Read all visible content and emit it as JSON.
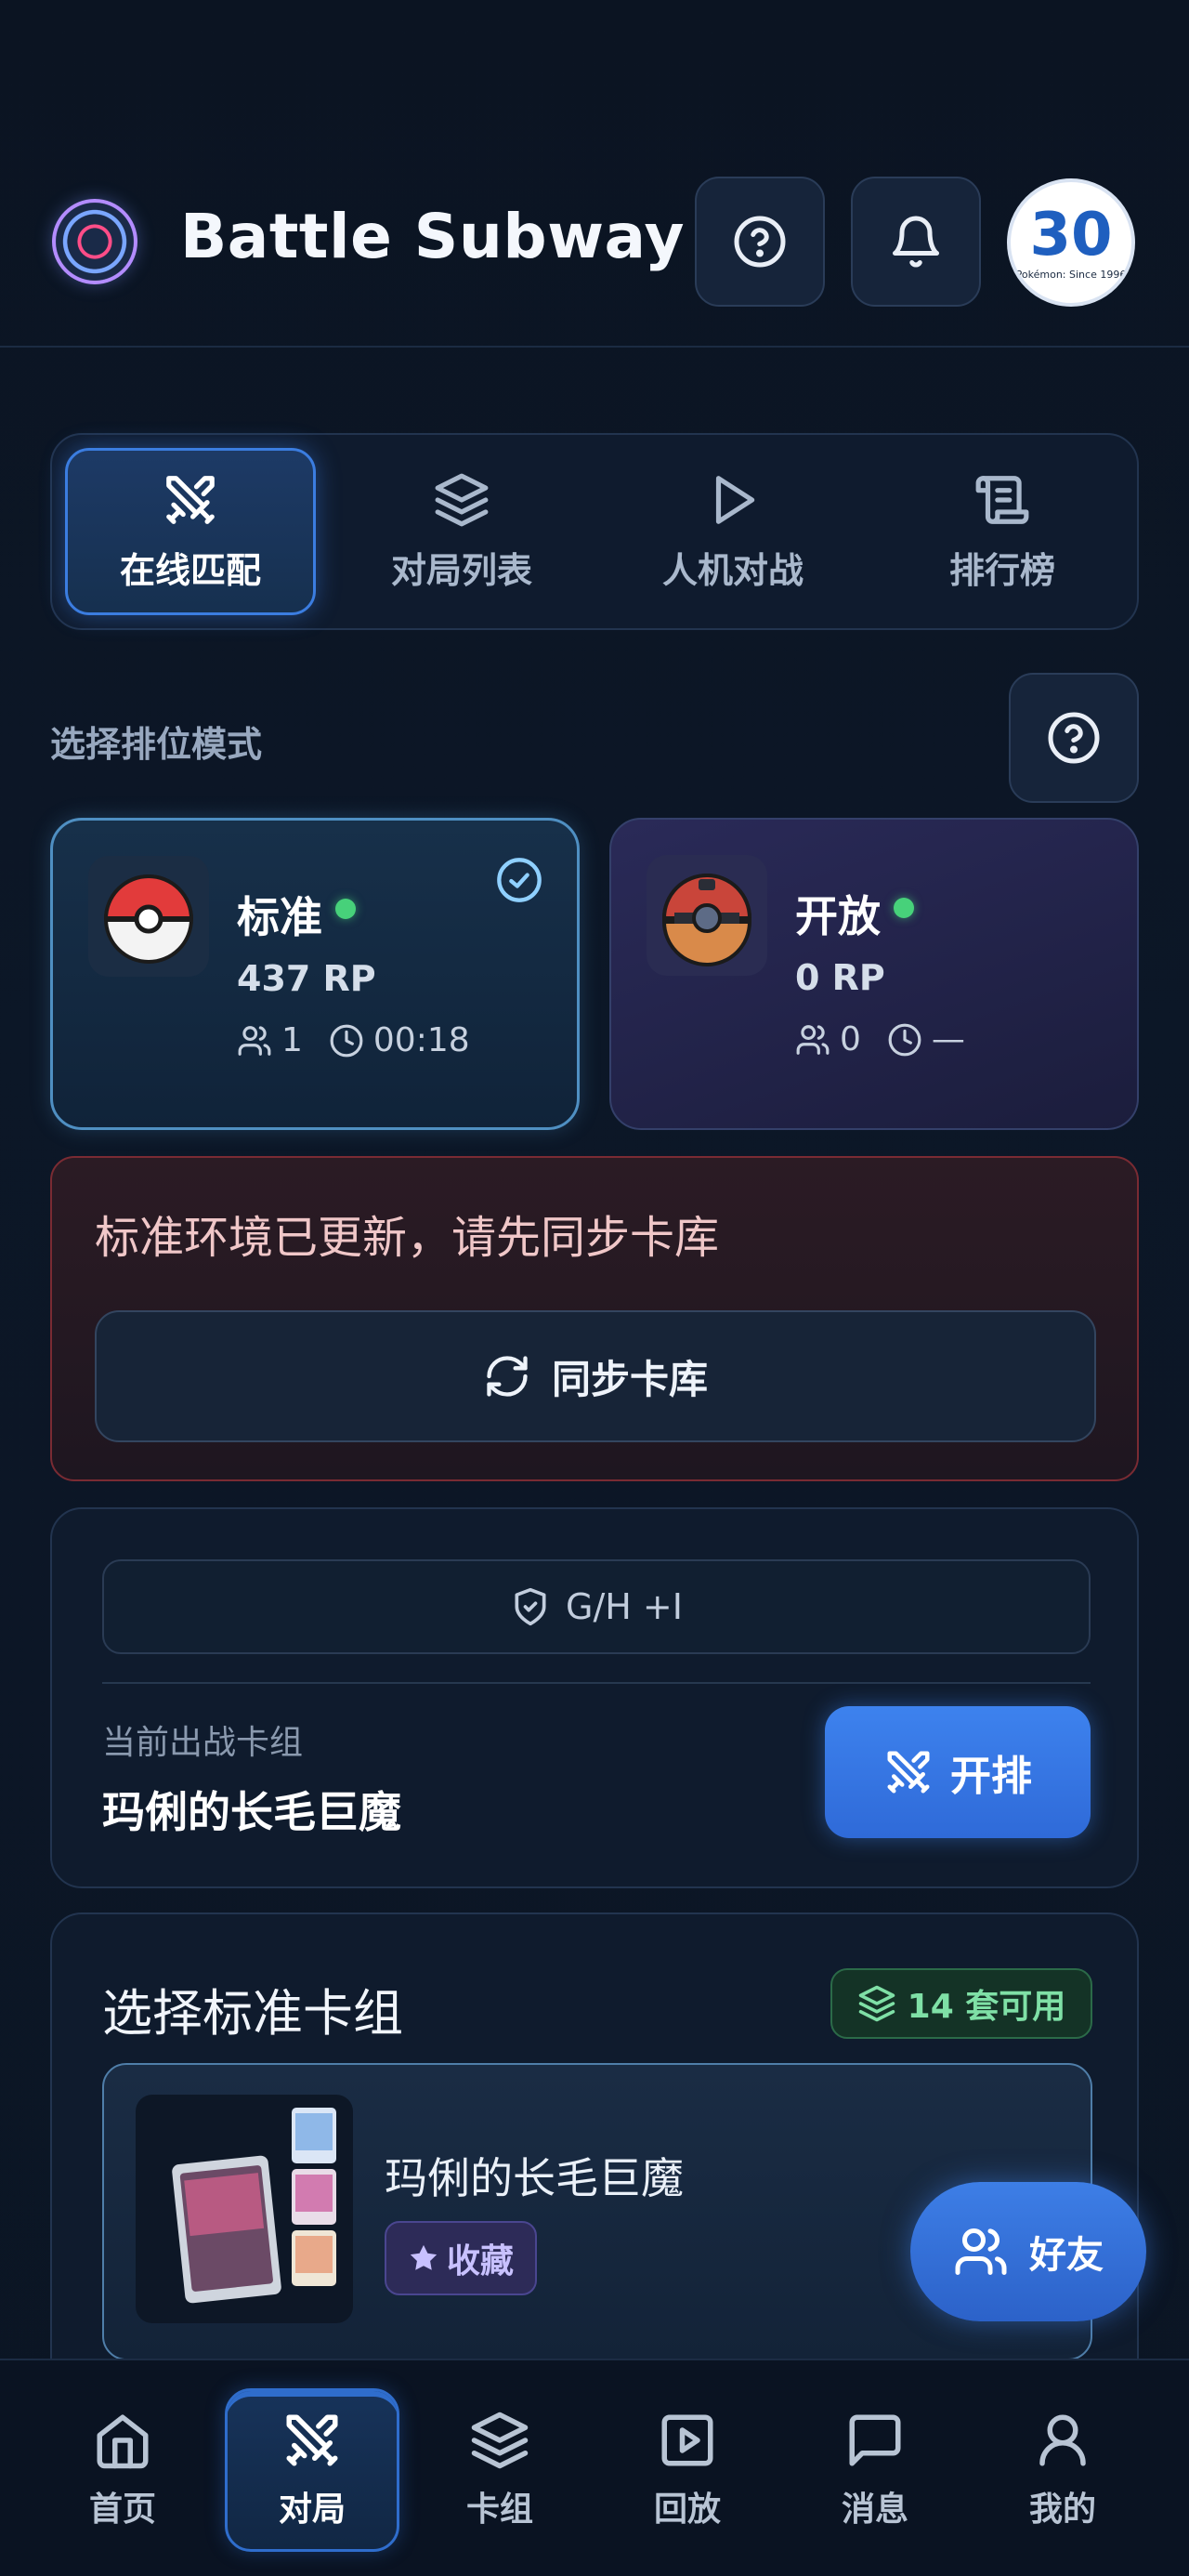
{
  "header": {
    "title": "Battle Subway",
    "avatar_big": "30",
    "avatar_small": "Pokémon: Since 1996"
  },
  "tabs": [
    {
      "label": "在线匹配",
      "icon": "swords-icon",
      "active": true
    },
    {
      "label": "对局列表",
      "icon": "layers-icon",
      "active": false
    },
    {
      "label": "人机对战",
      "icon": "play-icon",
      "active": false
    },
    {
      "label": "排行榜",
      "icon": "scroll-icon",
      "active": false
    }
  ],
  "rank_section": {
    "label": "选择排位模式",
    "modes": [
      {
        "name": "标准",
        "rp": "437 RP",
        "players": "1",
        "time": "00:18",
        "selected": true
      },
      {
        "name": "开放",
        "rp": "0 RP",
        "players": "0",
        "time": "—",
        "selected": false
      }
    ]
  },
  "alert": {
    "message": "标准环境已更新，请先同步卡库",
    "button": "同步卡库"
  },
  "deck_panel": {
    "rule": "G/H +I",
    "current_label": "当前出战卡组",
    "current_deck": "玛俐的长毛巨魔",
    "start_button": "开排"
  },
  "select_deck": {
    "title": "选择标准卡组",
    "available": "14 套可用",
    "decks": [
      {
        "name": "玛俐的长毛巨魔",
        "tag": "收藏"
      }
    ]
  },
  "fab": {
    "label": "好友"
  },
  "bottom_nav": [
    {
      "label": "首页",
      "icon": "home-icon"
    },
    {
      "label": "对局",
      "icon": "swords-icon"
    },
    {
      "label": "卡组",
      "icon": "layers-icon"
    },
    {
      "label": "回放",
      "icon": "replay-icon"
    },
    {
      "label": "消息",
      "icon": "message-icon"
    },
    {
      "label": "我的",
      "icon": "user-icon"
    }
  ],
  "colors": {
    "accent": "#3d82ee",
    "online": "#47d17a",
    "alert_border": "#7a2b33",
    "available": "#7fe0a6"
  }
}
